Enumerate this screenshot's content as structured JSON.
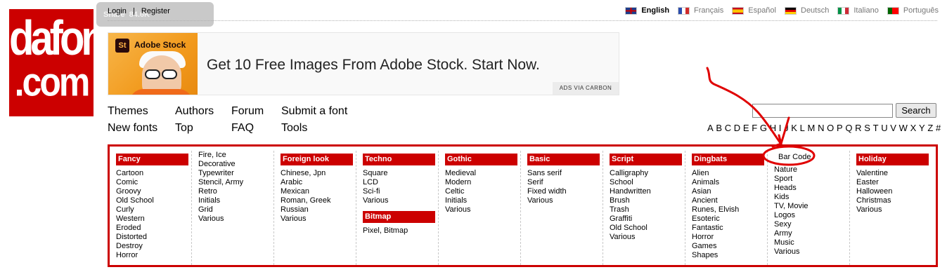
{
  "logo": {
    "line1": "dafont",
    "line2": ".com"
  },
  "login": {
    "login": "Login",
    "sep": "|",
    "register": "Register",
    "ghost_label": "Share",
    "ghost_count": "84.6K"
  },
  "languages": [
    {
      "label": "English",
      "flag": "uk-flag-icon",
      "active": true
    },
    {
      "label": "Français",
      "flag": "france-flag-icon"
    },
    {
      "label": "Español",
      "flag": "spain-flag-icon"
    },
    {
      "label": "Deutsch",
      "flag": "germany-flag-icon"
    },
    {
      "label": "Italiano",
      "flag": "italy-flag-icon"
    },
    {
      "label": "Português",
      "flag": "portugal-flag-icon"
    }
  ],
  "ad": {
    "logo_text": "St",
    "brand": "Adobe Stock",
    "headline": "Get 10 Free Images From Adobe Stock. Start Now.",
    "carbon": "ADS VIA CARBON"
  },
  "nav": {
    "themes": "Themes",
    "new_fonts": "New fonts",
    "authors": "Authors",
    "top": "Top",
    "forum": "Forum",
    "faq": "FAQ",
    "submit": "Submit a font",
    "tools": "Tools"
  },
  "search": {
    "button": "Search",
    "value": ""
  },
  "alphabet": [
    "A",
    "B",
    "C",
    "D",
    "E",
    "F",
    "G",
    "H",
    "I",
    "J",
    "K",
    "L",
    "M",
    "N",
    "O",
    "P",
    "Q",
    "R",
    "S",
    "T",
    "U",
    "V",
    "W",
    "X",
    "Y",
    "Z",
    "#"
  ],
  "categories": {
    "fancy": {
      "title": "Fancy",
      "items": [
        "Cartoon",
        "Comic",
        "Groovy",
        "Old School",
        "Curly",
        "Western",
        "Eroded",
        "Distorted",
        "Destroy",
        "Horror"
      ]
    },
    "fancy2": {
      "items": [
        "Fire, Ice",
        "Decorative",
        "Typewriter",
        "Stencil, Army",
        "Retro",
        "Initials",
        "Grid",
        "Various"
      ]
    },
    "foreign": {
      "title": "Foreign look",
      "items": [
        "Chinese, Jpn",
        "Arabic",
        "Mexican",
        "Roman, Greek",
        "Russian",
        "Various"
      ]
    },
    "techno": {
      "title": "Techno",
      "items": [
        "Square",
        "LCD",
        "Sci-fi",
        "Various"
      ]
    },
    "bitmap": {
      "title": "Bitmap",
      "items": [
        "Pixel, Bitmap"
      ]
    },
    "gothic": {
      "title": "Gothic",
      "items": [
        "Medieval",
        "Modern",
        "Celtic",
        "Initials",
        "Various"
      ]
    },
    "basic": {
      "title": "Basic",
      "items": [
        "Sans serif",
        "Serif",
        "Fixed width",
        "Various"
      ]
    },
    "script": {
      "title": "Script",
      "items": [
        "Calligraphy",
        "School",
        "Handwritten",
        "Brush",
        "Trash",
        "Graffiti",
        "Old School",
        "Various"
      ]
    },
    "dingbats": {
      "title": "Dingbats",
      "items": [
        "Alien",
        "Animals",
        "Asian",
        "Ancient",
        "Runes, Elvish",
        "Esoteric",
        "Fantastic",
        "Horror",
        "Games",
        "Shapes"
      ]
    },
    "dingbats2": {
      "items": [
        "Bar Code",
        "Nature",
        "Sport",
        "Heads",
        "Kids",
        "TV, Movie",
        "Logos",
        "Sexy",
        "Army",
        "Music",
        "Various"
      ]
    },
    "holiday": {
      "title": "Holiday",
      "items": [
        "Valentine",
        "Easter",
        "Halloween",
        "Christmas",
        "Various"
      ]
    }
  },
  "colors": {
    "brand_red": "#cc0000",
    "annotation_red": "#e00000"
  }
}
